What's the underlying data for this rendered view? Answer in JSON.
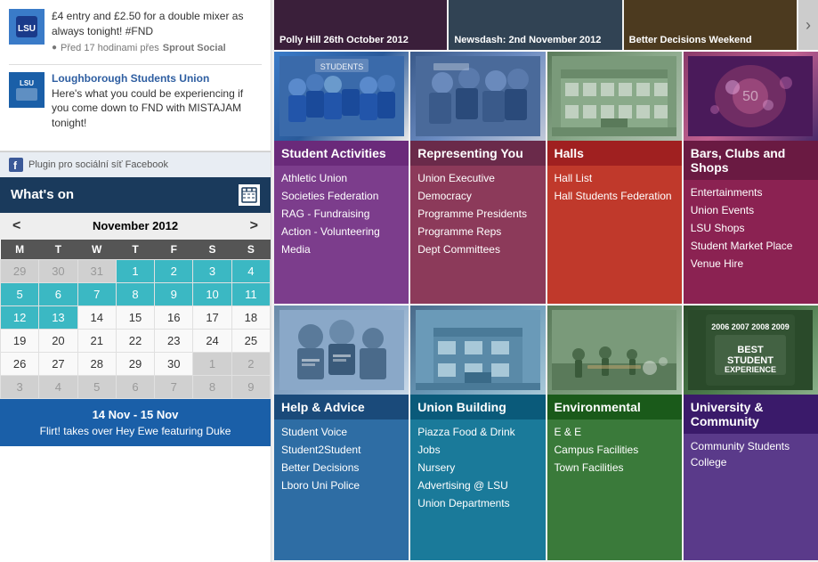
{
  "sidebar": {
    "posts": [
      {
        "avatar_initials": "LSU",
        "avatar_bg": "#e8e8e8",
        "has_image": true,
        "name": "",
        "text": "£4 entry and £2.50 for a double mixer as always tonight! #FND",
        "meta_time": "Před 17 hodinami přes",
        "meta_source": "Sprout Social"
      },
      {
        "avatar_initials": "LSU",
        "avatar_bg": "#2e5ea1",
        "name": "Loughborough Students Union",
        "text": "Here's what you could be experiencing if you come down to FND with MISTAJAM tonight!",
        "meta_time": "",
        "meta_source": ""
      }
    ],
    "fb_plugin_text": "Plugin pro sociální síť Facebook"
  },
  "whats_on": {
    "title": "What's on",
    "month": "November 2012",
    "days_header": [
      "M",
      "T",
      "W",
      "T",
      "F",
      "S",
      "S"
    ],
    "weeks": [
      [
        "29",
        "30",
        "31",
        "1",
        "2",
        "3",
        "4"
      ],
      [
        "5",
        "6",
        "7",
        "8",
        "9",
        "10",
        "11"
      ],
      [
        "12",
        "13",
        "14",
        "15",
        "16",
        "17",
        "18"
      ],
      [
        "19",
        "20",
        "21",
        "22",
        "23",
        "24",
        "25"
      ],
      [
        "26",
        "27",
        "28",
        "29",
        "30",
        "1",
        "2"
      ],
      [
        "3",
        "4",
        "5",
        "6",
        "7",
        "8",
        "9"
      ]
    ],
    "teal_days": [
      "29",
      "30",
      "31",
      "1",
      "2",
      "3",
      "4",
      "5",
      "6",
      "7",
      "8",
      "9",
      "10",
      "11",
      "12",
      "13"
    ],
    "event": {
      "date_range": "14 Nov - 15 Nov",
      "title": "Flirt! takes over Hey Ewe featuring Duke"
    }
  },
  "news_strip": {
    "items": [
      {
        "label": "Polly Hill 26th October 2012"
      },
      {
        "label": "Newsdash: 2nd November 2012"
      },
      {
        "label": "Better Decisions Weekend"
      }
    ],
    "arrow_label": "›"
  },
  "tiles": {
    "top": [
      {
        "id": "student-activities",
        "header": "Student Activities",
        "links": [
          "Athletic Union",
          "Societies Federation",
          "RAG - Fundraising",
          "Action - Volunteering",
          "Media"
        ]
      },
      {
        "id": "representing-you",
        "header": "Representing You",
        "links": [
          "Union Executive",
          "Democracy",
          "Programme Presidents",
          "Programme Reps",
          "Dept Committees"
        ]
      },
      {
        "id": "halls",
        "header": "Halls",
        "links": [
          "Hall List",
          "Hall Students Federation"
        ]
      },
      {
        "id": "bars-clubs-shops",
        "header": "Bars, Clubs and Shops",
        "links": [
          "Entertainments",
          "Union Events",
          "LSU Shops",
          "Student Market Place",
          "Venue Hire"
        ]
      }
    ],
    "bottom": [
      {
        "id": "help-advice",
        "header": "Help & Advice",
        "links": [
          "Student Voice",
          "Student2Student",
          "Better Decisions",
          "Lboro Uni Police"
        ]
      },
      {
        "id": "union-building",
        "header": "Union Building",
        "links": [
          "Piazza Food & Drink",
          "Jobs",
          "Nursery",
          "Advertising @ LSU",
          "Union Departments"
        ]
      },
      {
        "id": "environmental",
        "header": "Environmental",
        "links": [
          "E & E",
          "Campus Facilities",
          "Town Facilities"
        ]
      },
      {
        "id": "university-community",
        "header": "University & Community",
        "links": [
          "Community Students College"
        ]
      }
    ]
  }
}
